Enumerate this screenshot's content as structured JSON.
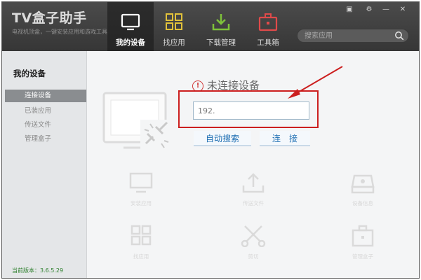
{
  "app": {
    "title": "TV盒子助手",
    "slogan": "电视机顶盒，一键安装应用和游戏工具"
  },
  "window_controls": {
    "skin": "▣",
    "settings": "⚙",
    "minimize": "—",
    "close": "✕"
  },
  "nav": [
    {
      "label": "我的设备",
      "icon": "tv-icon",
      "active": true
    },
    {
      "label": "找应用",
      "icon": "grid-icon",
      "active": false
    },
    {
      "label": "下载管理",
      "icon": "download-icon",
      "active": false
    },
    {
      "label": "工具箱",
      "icon": "toolbox-icon",
      "active": false
    }
  ],
  "search": {
    "placeholder": "搜索应用"
  },
  "sidebar": {
    "title": "我的设备",
    "items": [
      {
        "label": "连接设备",
        "active": true
      },
      {
        "label": "已装应用",
        "active": false
      },
      {
        "label": "传送文件",
        "active": false
      },
      {
        "label": "管理盒子",
        "active": false
      }
    ],
    "version": "当前版本：3.6.5.29"
  },
  "main": {
    "status": "未连接设备",
    "ip_input_value": "192.",
    "auto_search_label": "自动搜索",
    "connect_label": "连　接"
  },
  "tools": [
    {
      "label": "安装应用",
      "icon": "monitor-icon"
    },
    {
      "label": "传送文件",
      "icon": "upload-icon"
    },
    {
      "label": "设备信息",
      "icon": "drive-icon"
    },
    {
      "label": "找应用",
      "icon": "grid-icon"
    },
    {
      "label": "剪切",
      "icon": "scissors-icon"
    },
    {
      "label": "管理盒子",
      "icon": "box-icon"
    }
  ],
  "colors": {
    "topbar": "#3f3f3f",
    "accent_blue": "#1f6fb3",
    "highlight_red": "#cc1f1f",
    "version_green": "#2a7e2a"
  }
}
